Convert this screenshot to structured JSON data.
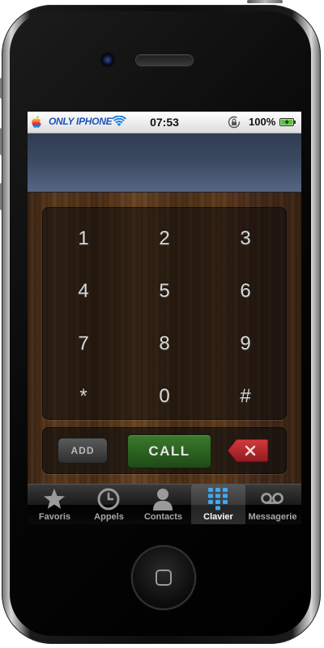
{
  "status_bar": {
    "carrier": "ONLY IPHONE",
    "time": "07:53",
    "battery_percent": "100%",
    "battery_level": 1.0
  },
  "dialer": {
    "entered_number": "",
    "keys": [
      "1",
      "2",
      "3",
      "4",
      "5",
      "6",
      "7",
      "8",
      "9",
      "*",
      "0",
      "#"
    ],
    "add_label": "ADD",
    "call_label": "CALL"
  },
  "tab_bar": {
    "active": "Clavier",
    "tabs": [
      {
        "label": "Favoris",
        "icon": "star-icon"
      },
      {
        "label": "Appels",
        "icon": "clock-icon"
      },
      {
        "label": "Contacts",
        "icon": "person-icon"
      },
      {
        "label": "Clavier",
        "icon": "keypad-icon"
      },
      {
        "label": "Messagerie",
        "icon": "voicemail-icon"
      }
    ]
  },
  "colors": {
    "call_green": "#2e6a23",
    "delete_red": "#b3262b",
    "active_tab_icon": "#3fa9f5",
    "carrier_blue": "#1a4fb8"
  }
}
